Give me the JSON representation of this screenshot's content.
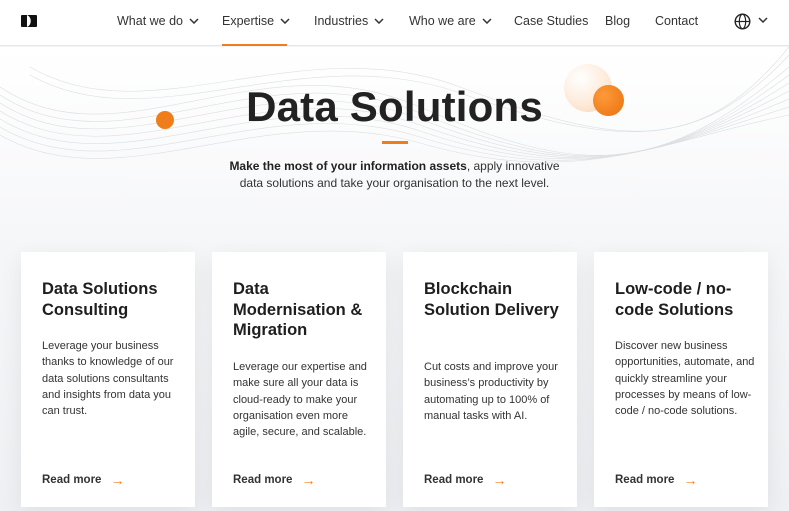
{
  "nav": {
    "items": [
      {
        "label": "What we do",
        "has_dropdown": true
      },
      {
        "label": "Expertise",
        "has_dropdown": true,
        "active": true
      },
      {
        "label": "Industries",
        "has_dropdown": true
      },
      {
        "label": "Who we are",
        "has_dropdown": true
      },
      {
        "label": "Case Studies",
        "has_dropdown": false
      },
      {
        "label": "Blog",
        "has_dropdown": false
      },
      {
        "label": "Contact",
        "has_dropdown": false
      }
    ],
    "language_icon": "globe-icon"
  },
  "hero": {
    "title": "Data Solutions",
    "subtitle_bold": "Make the most of your information assets",
    "subtitle_rest_1": ", apply innovative",
    "subtitle_rest_2": "data solutions and take your organisation to the next level."
  },
  "cards": [
    {
      "title": "Data Solutions Consulting",
      "description": "Leverage your business thanks to knowledge of our data solutions consultants and insights from data you can trust.",
      "link": "Read more"
    },
    {
      "title": "Data Modernisation & Migration",
      "description": "Leverage our expertise and make sure all your data is cloud-ready to make your organisation even more agile, secure, and scalable.",
      "link": "Read more"
    },
    {
      "title": "Blockchain Solution Delivery",
      "description": "Cut costs and improve your business’s productivity by automating up to 100% of manual tasks with AI.",
      "link": "Read more"
    },
    {
      "title": "Low-code / no-code Solutions",
      "description": "Discover new business opportunities, automate, and quickly streamline your processes by means of low-code / no-code solutions.",
      "link": "Read more"
    }
  ],
  "colors": {
    "accent": "#ef7d1a",
    "text": "#222222",
    "background": "#f4f5f7"
  }
}
